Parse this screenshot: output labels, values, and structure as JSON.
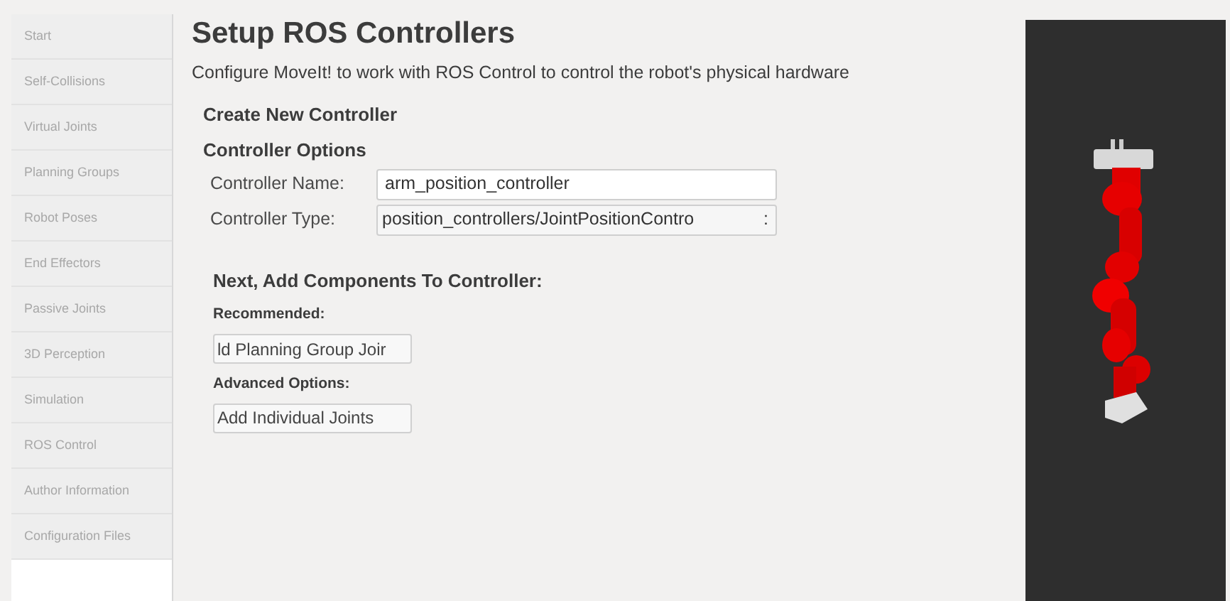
{
  "sidebar": {
    "items": [
      {
        "label": "Start"
      },
      {
        "label": "Self-Collisions"
      },
      {
        "label": "Virtual Joints"
      },
      {
        "label": "Planning Groups"
      },
      {
        "label": "Robot Poses"
      },
      {
        "label": "End Effectors"
      },
      {
        "label": "Passive Joints"
      },
      {
        "label": "3D Perception"
      },
      {
        "label": "Simulation"
      },
      {
        "label": "ROS Control"
      },
      {
        "label": "Author Information"
      },
      {
        "label": "Configuration Files"
      }
    ]
  },
  "title": "Setup ROS Controllers",
  "description": "Configure MoveIt! to work with ROS Control to control the robot's physical hardware",
  "section": "Create New Controller",
  "options_heading": "Controller Options",
  "fields": [
    {
      "kind": "text",
      "label": "Controller Name:",
      "value": "arm_position_controller"
    },
    {
      "kind": "combo",
      "label": "Controller Type:",
      "value": "position_controllers/JointPositionContro",
      "indicator": ":"
    }
  ],
  "components_heading": "Next, Add Components To Controller:",
  "groups": [
    {
      "label": "Recommended:",
      "button": "ld Planning Group Joir"
    },
    {
      "label": "Advanced Options:",
      "button": "Add Individual Joints"
    }
  ]
}
